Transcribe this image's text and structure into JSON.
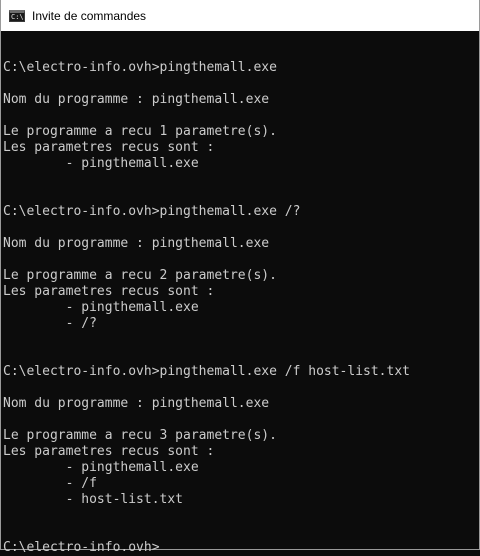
{
  "window": {
    "title": "Invite de commandes",
    "icon": "cmd-icon",
    "icon_glyph": "C:\\"
  },
  "console": {
    "lines": [
      "",
      "C:\\electro-info.ovh>pingthemall.exe",
      "",
      "Nom du programme : pingthemall.exe",
      "",
      "Le programme a recu 1 parametre(s).",
      "Les parametres recus sont :",
      "        - pingthemall.exe",
      "",
      "",
      "C:\\electro-info.ovh>pingthemall.exe /?",
      "",
      "Nom du programme : pingthemall.exe",
      "",
      "Le programme a recu 2 parametre(s).",
      "Les parametres recus sont :",
      "        - pingthemall.exe",
      "        - /?",
      "",
      "",
      "C:\\electro-info.ovh>pingthemall.exe /f host-list.txt",
      "",
      "Nom du programme : pingthemall.exe",
      "",
      "Le programme a recu 3 parametre(s).",
      "Les parametres recus sont :",
      "        - pingthemall.exe",
      "        - /f",
      "        - host-list.txt",
      "",
      "",
      "C:\\electro-info.ovh>"
    ]
  }
}
